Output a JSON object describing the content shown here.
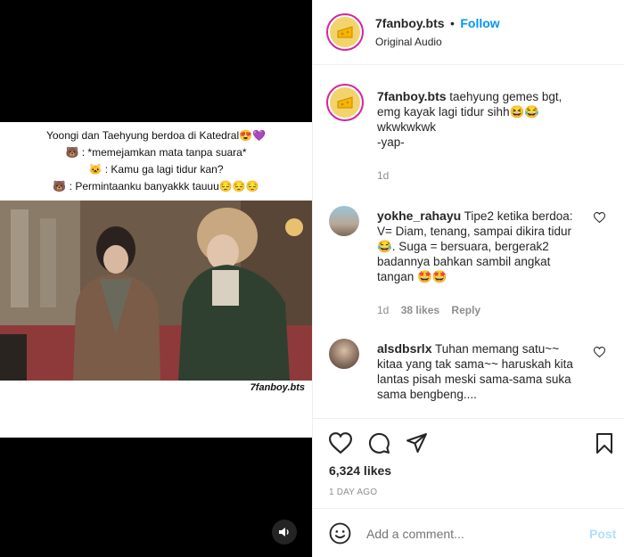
{
  "post": {
    "caption_lines": [
      "Yoongi dan Taehyung berdoa di Katedral😍💜",
      "🐻 : *memejamkan mata tanpa suara*",
      "🐱 : Kamu ga lagi tidur kan?",
      "🐻 : Permintaanku banyakkk tauuu😔😔😔"
    ],
    "watermark": "7fanboy.bts"
  },
  "header": {
    "username": "7fanboy.bts",
    "separator": "•",
    "follow_label": "Follow",
    "audio": "Original Audio"
  },
  "caption": {
    "username": "7fanboy.bts",
    "text": " taehyung gemes bgt, emg kayak lagi tidur sihh😆😂",
    "line2": "wkwkwkwk",
    "line3": "-yap-",
    "age": "1d"
  },
  "comments": [
    {
      "username": "yokhe_rahayu",
      "text": " Tipe2 ketika berdoa: V= Diam, tenang, sampai dikira tidur 😂. Suga = bersuara, bergerak2 badannya bahkan sambil angkat tangan 🤩🤩",
      "age": "1d",
      "likes": "38 likes",
      "reply": "Reply"
    },
    {
      "username": "alsdbsrlx",
      "text": " Tuhan memang satu~~ kitaa yang tak sama~~ haruskah kita lantas pisah meski sama-sama suka sama bengbeng....",
      "age": "",
      "likes": "",
      "reply": ""
    }
  ],
  "actions": {
    "likes": "6,324 likes",
    "time": "1 DAY AGO"
  },
  "add_comment": {
    "placeholder": "Add a comment...",
    "post_label": "Post"
  },
  "colors": {
    "follow": "#0095f6",
    "post_disabled": "#b2dffc",
    "muted": "#8e8e8e"
  }
}
